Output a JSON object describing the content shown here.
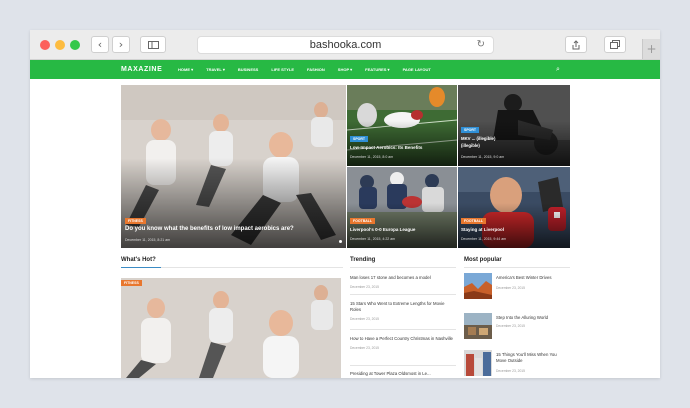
{
  "browser": {
    "url": "bashooka.com"
  },
  "site": {
    "logo": "MAXAZINE",
    "menu": [
      "HOME ▾",
      "TRAVEL ▾",
      "BUSINESS",
      "LIFE STYLE",
      "FASHION",
      "SHOP ▾",
      "FEATURES ▾",
      "PAGE LAYOUT"
    ]
  },
  "hero": {
    "main": {
      "badge": "FITNESS",
      "title": "Do you know what the benefits of low impact aerobics are?",
      "date": "December 11, 2015, 8:21 am"
    },
    "top_mid": {
      "badge": "SPORT",
      "title": "Low-Impact Aerobics: Its Benefits",
      "date": "December 11, 2015, 8:0 am"
    },
    "top_right": {
      "badge": "SPORT",
      "title": "MKV ... (illegible)",
      "subtitle": "(illegible)",
      "date": "December 11, 2015, 9:0 am"
    },
    "bottom_mid": {
      "badge": "FOOTBALL",
      "title": "Liverpool's 0-0 Europa League",
      "date": "December 11, 2015, 4:22 am"
    },
    "bottom_right": {
      "badge": "FOOTBALL",
      "title": "Staying at Liverpool",
      "date": "December 11, 2015, 9:44 am"
    }
  },
  "whats_hot": {
    "title": "What's Hot?",
    "badge": "FITNESS"
  },
  "trending": {
    "title": "Trending",
    "items": [
      {
        "title": "Man loses 17 stone and becomes a model",
        "date": "December 23, 2015"
      },
      {
        "title": "15 Stars Who Went to Extreme Lengths for Movie Roles",
        "date": "December 23, 2015"
      },
      {
        "title": "How to Have a Perfect Country Christmas in Nashville",
        "date": "December 23, 2015"
      },
      {
        "title": "Presiding at Tower Plaza Oldsmost in Le...",
        "date": ""
      }
    ]
  },
  "most_popular": {
    "title": "Most popular",
    "items": [
      {
        "title": "America's Best Winter Drives",
        "date": "December 23, 2015"
      },
      {
        "title": "Step Into the Alluring World",
        "date": "December 23, 2015"
      },
      {
        "title": "15 Things You'll Miss When You Move Outside",
        "date": "December 23, 2015"
      }
    ]
  },
  "colors": {
    "accent": "#27b944",
    "badge_orange": "#e8772e",
    "badge_blue": "#2f8fd6",
    "link_blue": "#3b8bc4"
  }
}
